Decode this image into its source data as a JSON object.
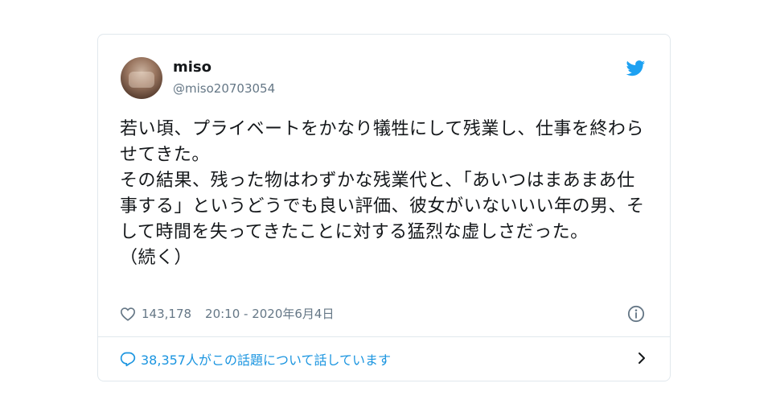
{
  "tweet": {
    "author": {
      "display_name": "miso",
      "handle": "@miso20703054"
    },
    "text": "若い頃、プライベートをかなり犠牲にして残業し、仕事を終わらせてきた。\nその結果、残った物はわずかな残業代と、「あいつはまあまあ仕事する」というどうでも良い評価、彼女がいないいい年の男、そして時間を失ってきたことに対する猛烈な虚しさだった。\n（続く）",
    "likes": "143,178",
    "timestamp": "20:10 - 2020年6月4日",
    "conversation_text": "38,357人がこの話題について話しています"
  },
  "colors": {
    "accent": "#1da1f2",
    "link": "#1b95e0",
    "muted": "#657786",
    "border": "#e1e8ed"
  },
  "icons": {
    "brand": "twitter-bird-icon",
    "like": "heart-icon",
    "info": "info-icon",
    "reply": "speech-bubble-icon",
    "more": "chevron-right-icon"
  }
}
